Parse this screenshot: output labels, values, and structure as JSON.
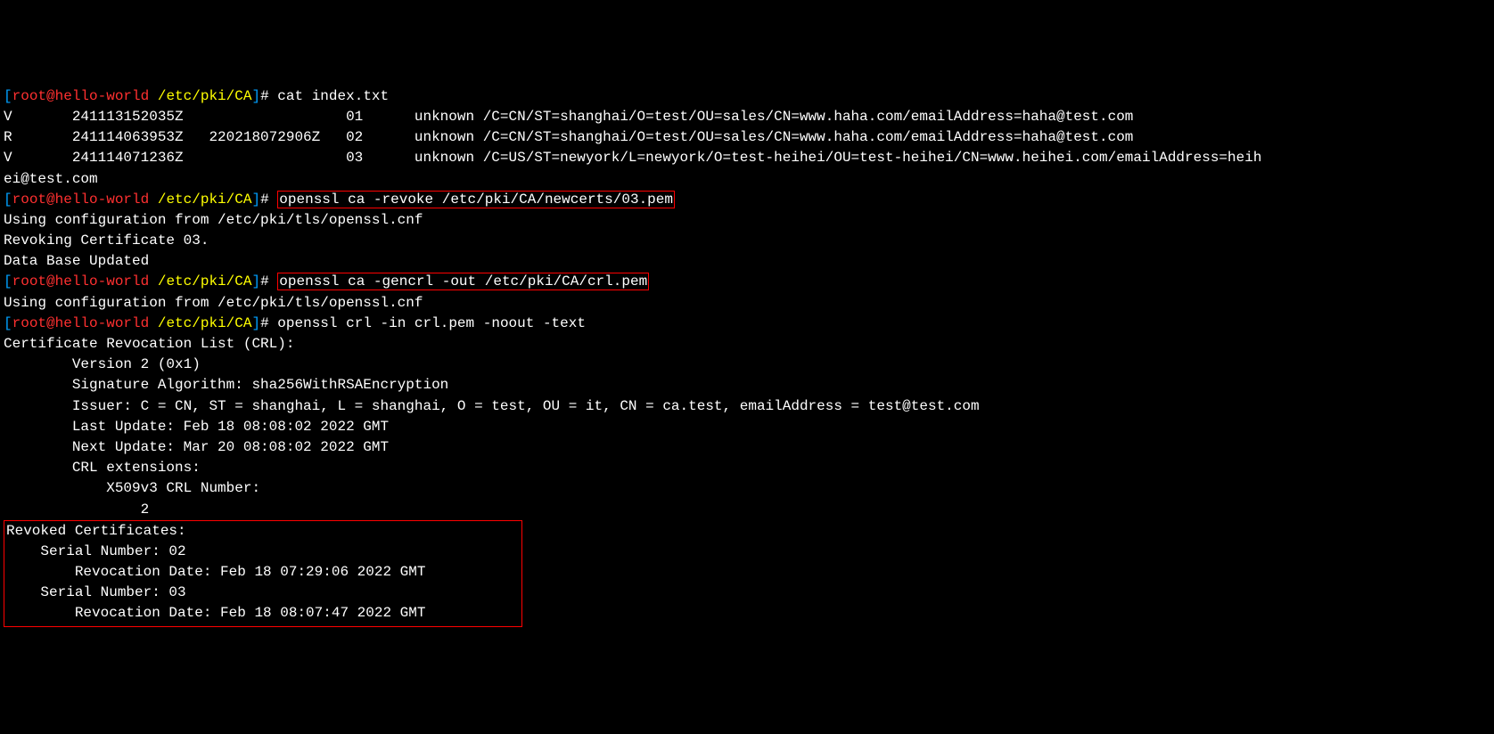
{
  "prompt": {
    "open": "[",
    "user_host": "root@hello-world",
    "path": "/etc/pki/CA",
    "close": "]",
    "hash": "#"
  },
  "cmd1": "cat index.txt",
  "index_rows": {
    "l1": "V       241113152035Z                   01      unknown /C=CN/ST=shanghai/O=test/OU=sales/CN=www.haha.com/emailAddress=haha@test.com",
    "l2": "R       241114063953Z   220218072906Z   02      unknown /C=CN/ST=shanghai/O=test/OU=sales/CN=www.haha.com/emailAddress=haha@test.com",
    "l3": "V       241114071236Z                   03      unknown /C=US/ST=newyork/L=newyork/O=test-heihei/OU=test-heihei/CN=www.heihei.com/emailAddress=heih",
    "l3b": "ei@test.com"
  },
  "cmd2": "openssl ca -revoke /etc/pki/CA/newcerts/03.pem",
  "revoke_out": {
    "l1": "Using configuration from /etc/pki/tls/openssl.cnf",
    "l2": "Revoking Certificate 03.",
    "l3": "Data Base Updated"
  },
  "cmd3": "openssl ca -gencrl -out /etc/pki/CA/crl.pem",
  "gencrl_out": "Using configuration from /etc/pki/tls/openssl.cnf",
  "cmd4": "openssl crl -in crl.pem -noout -text",
  "crl_out": {
    "l1": "Certificate Revocation List (CRL):",
    "l2": "        Version 2 (0x1)",
    "l3": "        Signature Algorithm: sha256WithRSAEncryption",
    "l4": "        Issuer: C = CN, ST = shanghai, L = shanghai, O = test, OU = it, CN = ca.test, emailAddress = test@test.com",
    "l5": "        Last Update: Feb 18 08:08:02 2022 GMT",
    "l6": "        Next Update: Mar 20 08:08:02 2022 GMT",
    "l7": "        CRL extensions:",
    "l8": "            X509v3 CRL Number: ",
    "l9": "                2"
  },
  "revoked_block": {
    "l1": "Revoked Certificates:",
    "l2": "    Serial Number: 02",
    "l3": "        Revocation Date: Feb 18 07:29:06 2022 GMT",
    "l4": "    Serial Number: 03",
    "l5": "        Revocation Date: Feb 18 08:07:47 2022 GMT"
  }
}
